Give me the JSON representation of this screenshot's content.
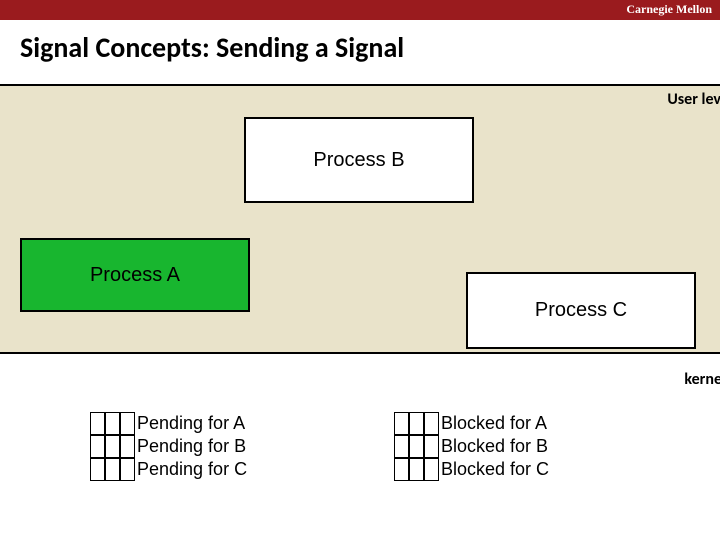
{
  "header": {
    "institution": "Carnegie Mellon",
    "title": "Signal Concepts: Sending a Signal"
  },
  "region": {
    "user_level_label": "User lev",
    "kernel_label": "kerne"
  },
  "processes": {
    "a": {
      "label": "Process A",
      "highlighted": true,
      "color": "#18b62f"
    },
    "b": {
      "label": "Process B",
      "highlighted": false
    },
    "c": {
      "label": "Process C",
      "highlighted": false
    }
  },
  "signal_state": {
    "pending": {
      "rows": [
        "Pending for A",
        "Pending for B",
        "Pending for C"
      ]
    },
    "blocked": {
      "rows": [
        "Blocked for A",
        "Blocked for B",
        "Blocked for C"
      ]
    },
    "bit_columns": 3
  }
}
